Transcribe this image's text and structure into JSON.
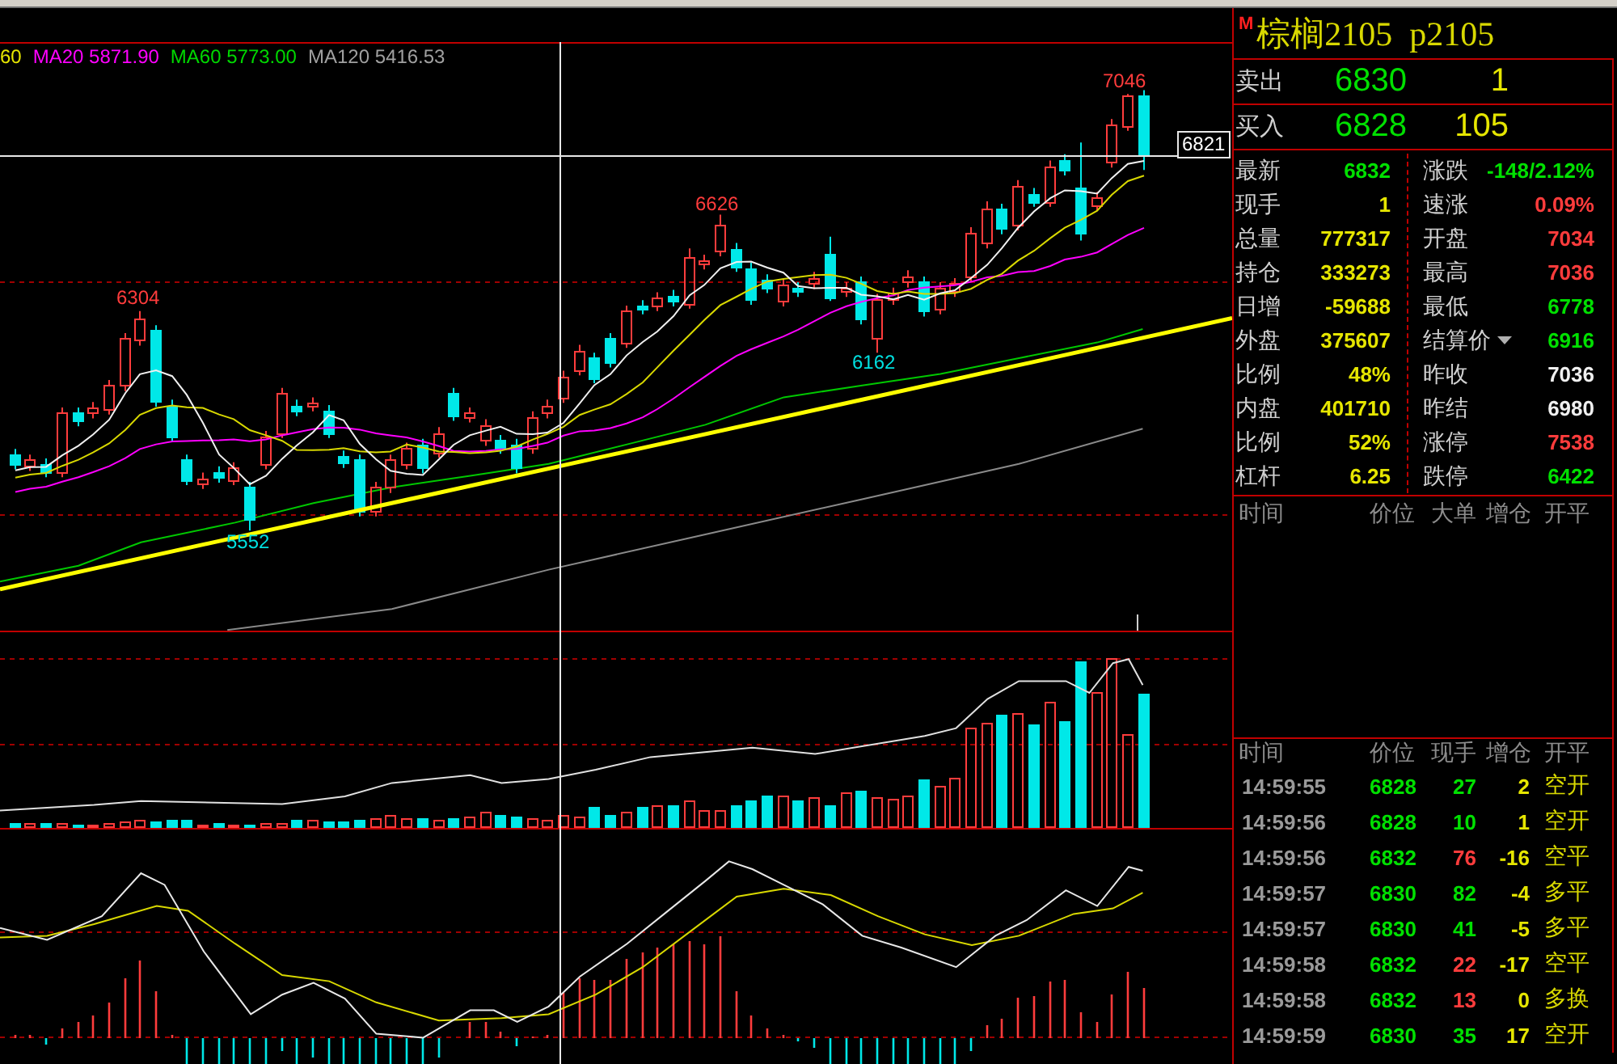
{
  "chart": {
    "legend": [
      {
        "text": "60",
        "color": "#e6e600"
      },
      {
        "text": "MA20 5871.90",
        "color": "#ff00ff"
      },
      {
        "text": "MA60 5773.00",
        "color": "#00d800"
      },
      {
        "text": "MA120 5416.53",
        "color": "#a0a0a0"
      }
    ],
    "price_labels": [
      {
        "text": "6304",
        "kind": "high"
      },
      {
        "text": "5552",
        "kind": "low"
      },
      {
        "text": "6626",
        "kind": "high"
      },
      {
        "text": "6162",
        "kind": "low"
      },
      {
        "text": "7046",
        "kind": "high"
      }
    ],
    "crosshair_price": "6821"
  },
  "quote": {
    "badge": "M",
    "title": "棕榈2105  p2105",
    "ask": {
      "label": "卖出",
      "price": "6830",
      "volume": "1"
    },
    "bid": {
      "label": "买入",
      "price": "6828",
      "volume": "105"
    },
    "stats": [
      {
        "cells": [
          {
            "label": "最新",
            "value": "6832",
            "color": "#00e000",
            "dropdown": false
          },
          {
            "label": "涨跌",
            "value": "-148/2.12%",
            "color": "#00e000",
            "dropdown": false
          }
        ]
      },
      {
        "cells": [
          {
            "label": "现手",
            "value": "1",
            "color": "#e6e600",
            "dropdown": false
          },
          {
            "label": "速涨",
            "value": "0.09%",
            "color": "#ff3c3c",
            "dropdown": false
          }
        ]
      },
      {
        "cells": [
          {
            "label": "总量",
            "value": "777317",
            "color": "#e6e600",
            "dropdown": false
          },
          {
            "label": "开盘",
            "value": "7034",
            "color": "#ff3c3c",
            "dropdown": false
          }
        ]
      },
      {
        "cells": [
          {
            "label": "持仓",
            "value": "333273",
            "color": "#e6e600",
            "dropdown": false
          },
          {
            "label": "最高",
            "value": "7036",
            "color": "#ff3c3c",
            "dropdown": false
          }
        ]
      },
      {
        "cells": [
          {
            "label": "日增",
            "value": "-59688",
            "color": "#e6e600",
            "dropdown": false
          },
          {
            "label": "最低",
            "value": "6778",
            "color": "#00e000",
            "dropdown": false
          }
        ]
      },
      {
        "cells": [
          {
            "label": "外盘",
            "value": "375607",
            "color": "#e6e600",
            "dropdown": false
          },
          {
            "label": "结算价",
            "value": "6916",
            "color": "#00e000",
            "dropdown": true
          }
        ]
      },
      {
        "cells": [
          {
            "label": "比例",
            "value": "48%",
            "color": "#e6e600",
            "dropdown": false
          },
          {
            "label": "昨收",
            "value": "7036",
            "color": "#f0f0f0",
            "dropdown": false
          }
        ]
      },
      {
        "cells": [
          {
            "label": "内盘",
            "value": "401710",
            "color": "#e6e600",
            "dropdown": false
          },
          {
            "label": "昨结",
            "value": "6980",
            "color": "#f0f0f0",
            "dropdown": false
          }
        ]
      },
      {
        "cells": [
          {
            "label": "比例",
            "value": "52%",
            "color": "#e6e600",
            "dropdown": false
          },
          {
            "label": "涨停",
            "value": "7538",
            "color": "#ff3c3c",
            "dropdown": false
          }
        ]
      },
      {
        "cells": [
          {
            "label": "杠杆",
            "value": "6.25",
            "color": "#e6e600",
            "dropdown": false
          },
          {
            "label": "跌停",
            "value": "6422",
            "color": "#00e000",
            "dropdown": false
          }
        ]
      }
    ]
  },
  "big_orders": {
    "columns": [
      "时间",
      "价位",
      "大单",
      "增仓",
      "开平"
    ]
  },
  "trades": {
    "columns": [
      "时间",
      "价位",
      "现手",
      "增仓",
      "开平"
    ],
    "rows": [
      {
        "time": "14:59:55",
        "price": "6828",
        "volume": "27",
        "change": "2",
        "type": "空开",
        "color": "#00e000"
      },
      {
        "time": "14:59:56",
        "price": "6828",
        "volume": "10",
        "change": "1",
        "type": "空开",
        "color": "#00e000"
      },
      {
        "time": "14:59:56",
        "price": "6832",
        "volume": "76",
        "change": "-16",
        "type": "空平",
        "color": "#ff3c3c"
      },
      {
        "time": "14:59:57",
        "price": "6830",
        "volume": "82",
        "change": "-4",
        "type": "多平",
        "color": "#00e000"
      },
      {
        "time": "14:59:57",
        "price": "6830",
        "volume": "41",
        "change": "-5",
        "type": "多平",
        "color": "#00e000"
      },
      {
        "time": "14:59:58",
        "price": "6832",
        "volume": "22",
        "change": "-17",
        "type": "空平",
        "color": "#ff3c3c"
      },
      {
        "time": "14:59:58",
        "price": "6832",
        "volume": "13",
        "change": "0",
        "type": "多换",
        "color": "#ff3c3c"
      },
      {
        "time": "14:59:59",
        "price": "6830",
        "volume": "35",
        "change": "17",
        "type": "空开",
        "color": "#00e000"
      }
    ]
  }
}
